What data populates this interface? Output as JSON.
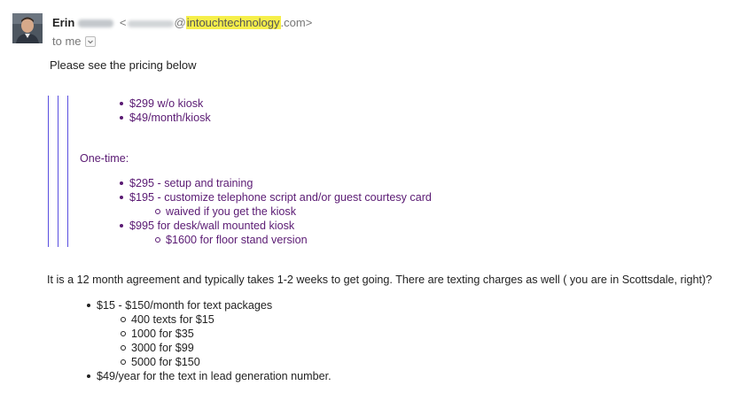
{
  "sender": {
    "name": "Erin",
    "email_open": "<",
    "email_domain": "intouchtechnology",
    "email_tld": ".com>"
  },
  "recipient": {
    "label": "to me"
  },
  "body": {
    "intro": "Please see the pricing below",
    "quoted": {
      "top_items": [
        "$299 w/o kiosk",
        "$49/month/kiosk"
      ],
      "one_time_heading": "One-time:",
      "one_time_items": [
        {
          "text": "$295 - setup and training",
          "sub": []
        },
        {
          "text": "$195 - customize telephone script and/or guest courtesy card",
          "sub": [
            "waived if you get the kiosk"
          ]
        },
        {
          "text": "$995 for desk/wall mounted kiosk",
          "sub": [
            "$1600 for floor stand version"
          ]
        }
      ]
    },
    "agreement": "It is a 12 month agreement and typically takes 1-2 weeks to get going. There are texting charges as well ( you are in Scottsdale, right)?",
    "texting_items": [
      {
        "text": "$15 - $150/month for text packages",
        "sub": [
          "400 texts for $15",
          "1000 for $35",
          "3000 for $99",
          "5000 for $150"
        ]
      },
      {
        "text": "$49/year for the text in lead generation number.",
        "sub": []
      }
    ]
  },
  "colors": {
    "quote_text": "#5a1a73",
    "quote_bar": "#5a4fe0",
    "highlight": "#f6ef4a"
  },
  "icons": {
    "avatar": "sender-avatar-photo",
    "dropdown": "chevron-down-icon"
  }
}
